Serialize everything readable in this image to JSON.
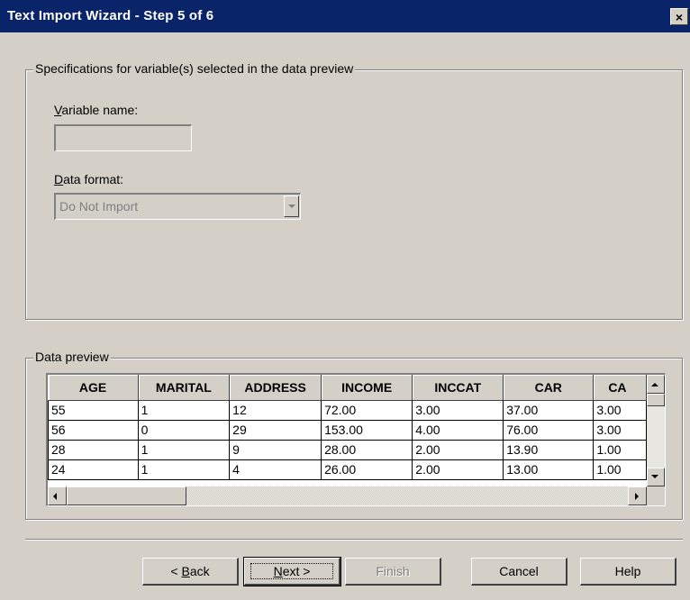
{
  "window": {
    "title": "Text Import Wizard - Step 5 of 6",
    "close_label": "×"
  },
  "specifications": {
    "legend": "Specifications for variable(s) selected in the data preview",
    "variable_name_label_accel": "V",
    "variable_name_label_rest": "ariable name:",
    "variable_name_value": "",
    "data_format_label_accel": "D",
    "data_format_label_rest": "ata format:",
    "data_format_value": "Do Not Import"
  },
  "preview": {
    "legend": "Data preview",
    "columns": [
      "AGE",
      "MARITAL",
      "ADDRESS",
      "INCOME",
      "INCCAT",
      "CAR",
      "CA"
    ],
    "rows": [
      [
        "55",
        "1",
        "12",
        "72.00",
        "3.00",
        "37.00",
        "3.00"
      ],
      [
        "56",
        "0",
        "29",
        "153.00",
        "4.00",
        "76.00",
        "3.00"
      ],
      [
        "28",
        "1",
        "9",
        "28.00",
        "2.00",
        "13.90",
        "1.00"
      ],
      [
        "24",
        "1",
        "4",
        "26.00",
        "2.00",
        "13.00",
        "1.00"
      ]
    ]
  },
  "buttons": {
    "back_prefix": "< ",
    "back_accel": "B",
    "back_rest": "ack",
    "next_accel": "N",
    "next_rest": "ext >",
    "finish": "Finish",
    "cancel": "Cancel",
    "help": "Help"
  },
  "colors": {
    "titlebar": "#0a246a",
    "face": "#d4d0c8"
  }
}
